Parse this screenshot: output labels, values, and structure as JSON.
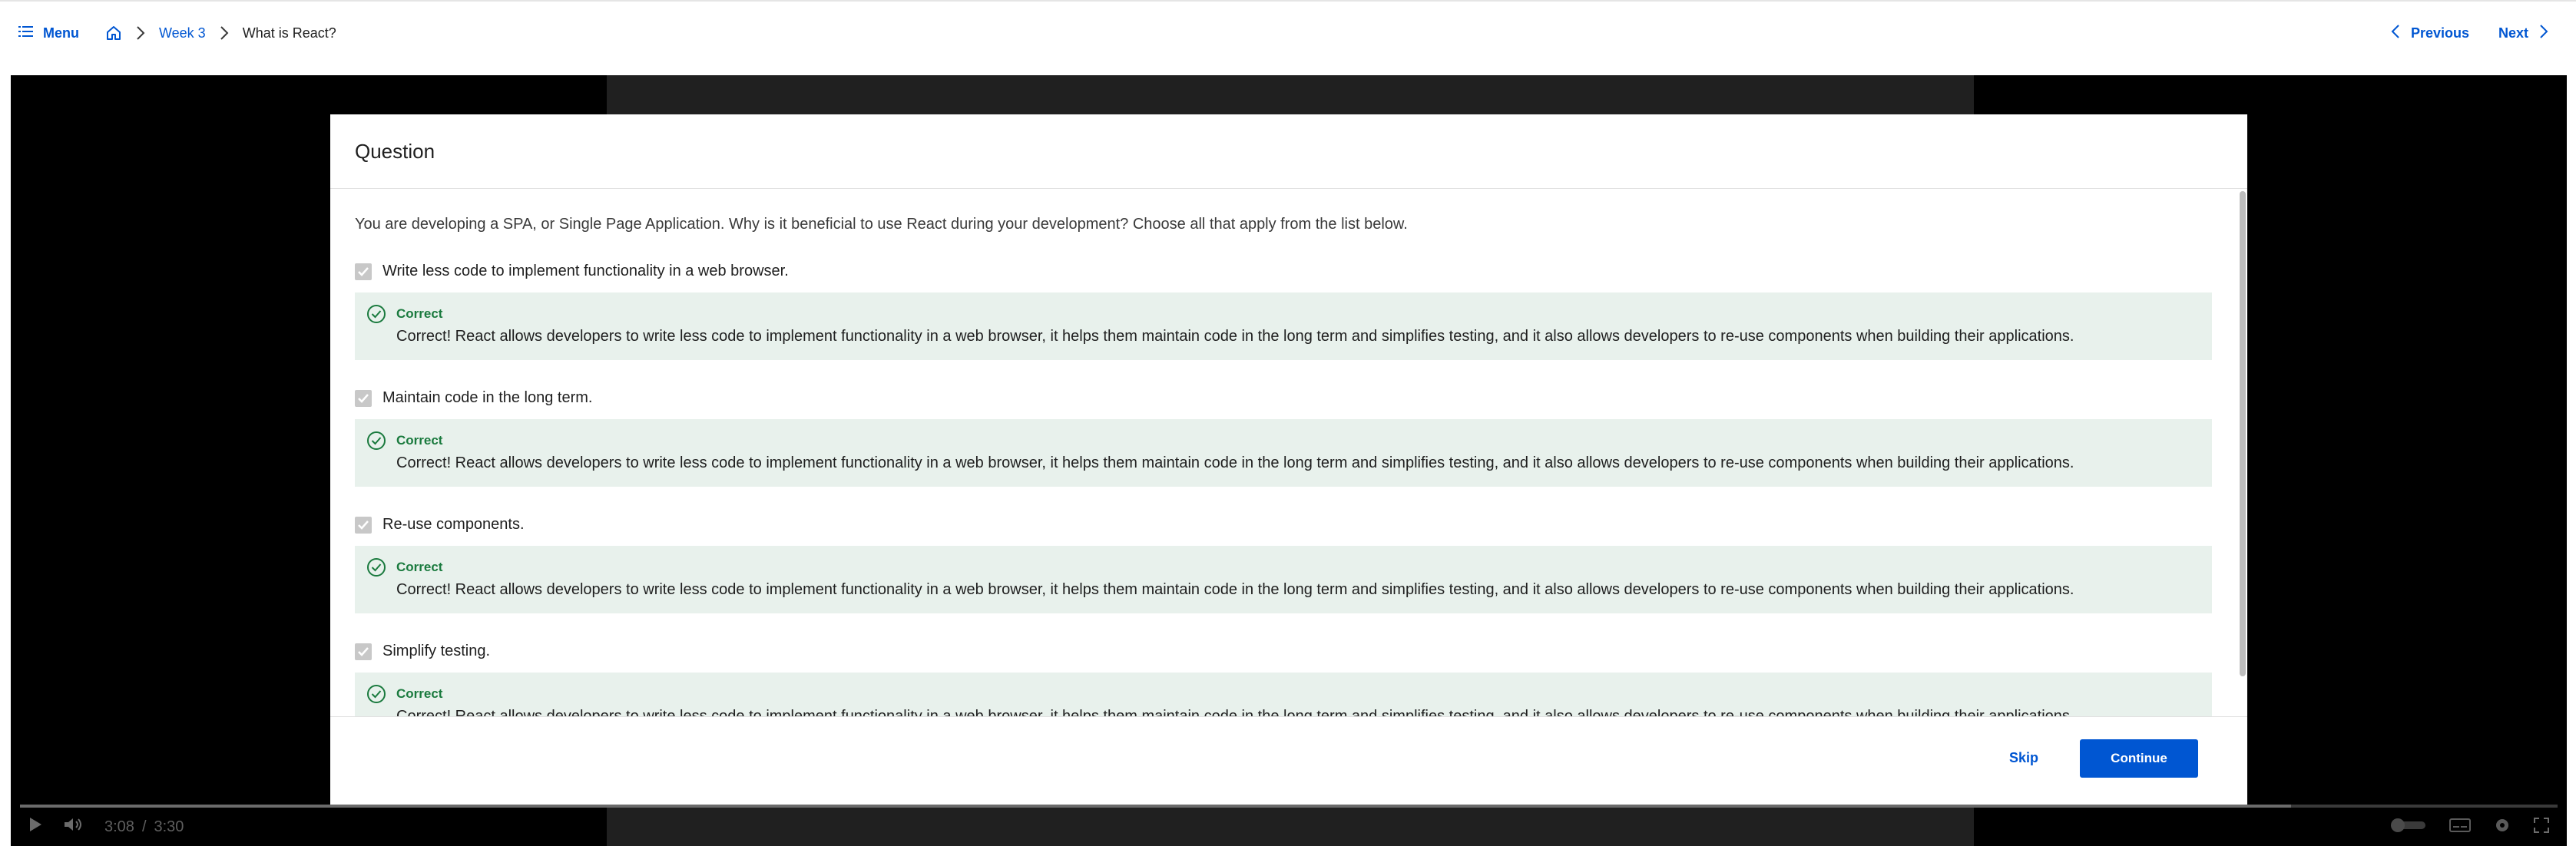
{
  "nav": {
    "menu_label": "Menu",
    "breadcrumb": [
      {
        "label": "Week 3"
      },
      {
        "label": "What is React?"
      }
    ],
    "previous_label": "Previous",
    "next_label": "Next"
  },
  "player": {
    "current_time": "3:08",
    "time_separator": "/",
    "duration": "3:30",
    "progress_fraction": 0.895
  },
  "modal": {
    "title": "Question",
    "question": "You are developing a SPA, or Single Page Application. Why is it beneficial to use React during your development? Choose all that apply from the list below.",
    "options": [
      {
        "label": "Write less code to implement functionality in a web browser.",
        "checked": true,
        "feedback_title": "Correct",
        "feedback_text": "Correct! React allows developers to write less code to implement functionality in a web browser, it helps them maintain code in the long term and simplifies testing, and it also allows developers to re-use components when building their applications."
      },
      {
        "label": "Maintain code in the long term.",
        "checked": true,
        "feedback_title": "Correct",
        "feedback_text": "Correct! React allows developers to write less code to implement functionality in a web browser, it helps them maintain code in the long term and simplifies testing, and it also allows developers to re-use components when building their applications."
      },
      {
        "label": "Re-use components.",
        "checked": true,
        "feedback_title": "Correct",
        "feedback_text": "Correct! React allows developers to write less code to implement functionality in a web browser, it helps them maintain code in the long term and simplifies testing, and it also allows developers to re-use components when building their applications."
      },
      {
        "label": "Simplify testing.",
        "checked": true,
        "feedback_title": "Correct",
        "feedback_text": "Correct! React allows developers to write less code to implement functionality in a web browser, it helps them maintain code in the long term and simplifies testing, and it also allows developers to re-use components when building their applications."
      }
    ],
    "skip_label": "Skip",
    "continue_label": "Continue"
  },
  "colors": {
    "accent": "#0056d2",
    "correct_green": "#1a7a3e",
    "feedback_bg": "#e8f1ec"
  },
  "icons": [
    "list-icon",
    "home-icon",
    "chevron-right-icon",
    "chevron-left-icon",
    "checkbox-checked-icon",
    "check-circle-icon",
    "play-icon",
    "volume-icon",
    "captions-icon",
    "settings-icon",
    "fullscreen-icon"
  ]
}
